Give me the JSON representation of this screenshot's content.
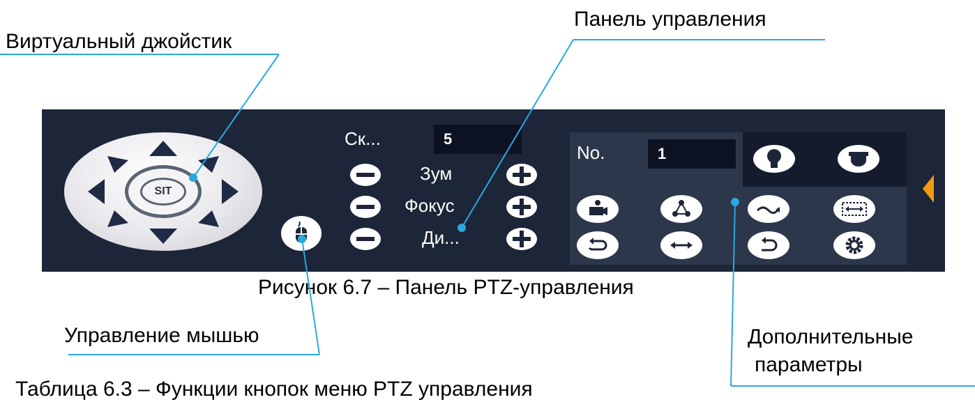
{
  "annotations": {
    "virtual_joystick": "Виртуальный джойстик",
    "control_panel": "Панель управления",
    "mouse_control": "Управление мышью",
    "additional_params_line1": "Дополнительные",
    "additional_params_line2": "параметры"
  },
  "captions": {
    "figure": "Рисунок 6.7 – Панель PTZ-управления",
    "table": "Таблица 6.3 – Функции кнопок меню PTZ управления"
  },
  "ptz_panel": {
    "joystick_center_label": "SIT",
    "speed_label": "Ск...",
    "speed_value": "5",
    "zoom_label": "Зум",
    "focus_label": "Фокус",
    "iris_label": "Ди...",
    "no_label": "No.",
    "no_value": "1"
  },
  "icons": [
    "arrow-up-icon",
    "arrow-down-icon",
    "arrow-left-icon",
    "arrow-right-icon",
    "arrow-up-left-icon",
    "arrow-up-right-icon",
    "arrow-down-left-icon",
    "arrow-down-right-icon",
    "mouse-icon",
    "light-bulb-icon",
    "dome-camera-icon",
    "camera-icon",
    "tour-icon",
    "pattern-icon",
    "border-scan-icon",
    "rotate-icon",
    "pan-icon",
    "flip-icon",
    "settings-gear-icon",
    "expand-arrow-icon"
  ],
  "colors": {
    "panel_bg": "#1d2638",
    "subpanel_bg": "#2d374b",
    "annotation_line": "#2aa8e0",
    "expand_arrow": "#f29a13"
  }
}
